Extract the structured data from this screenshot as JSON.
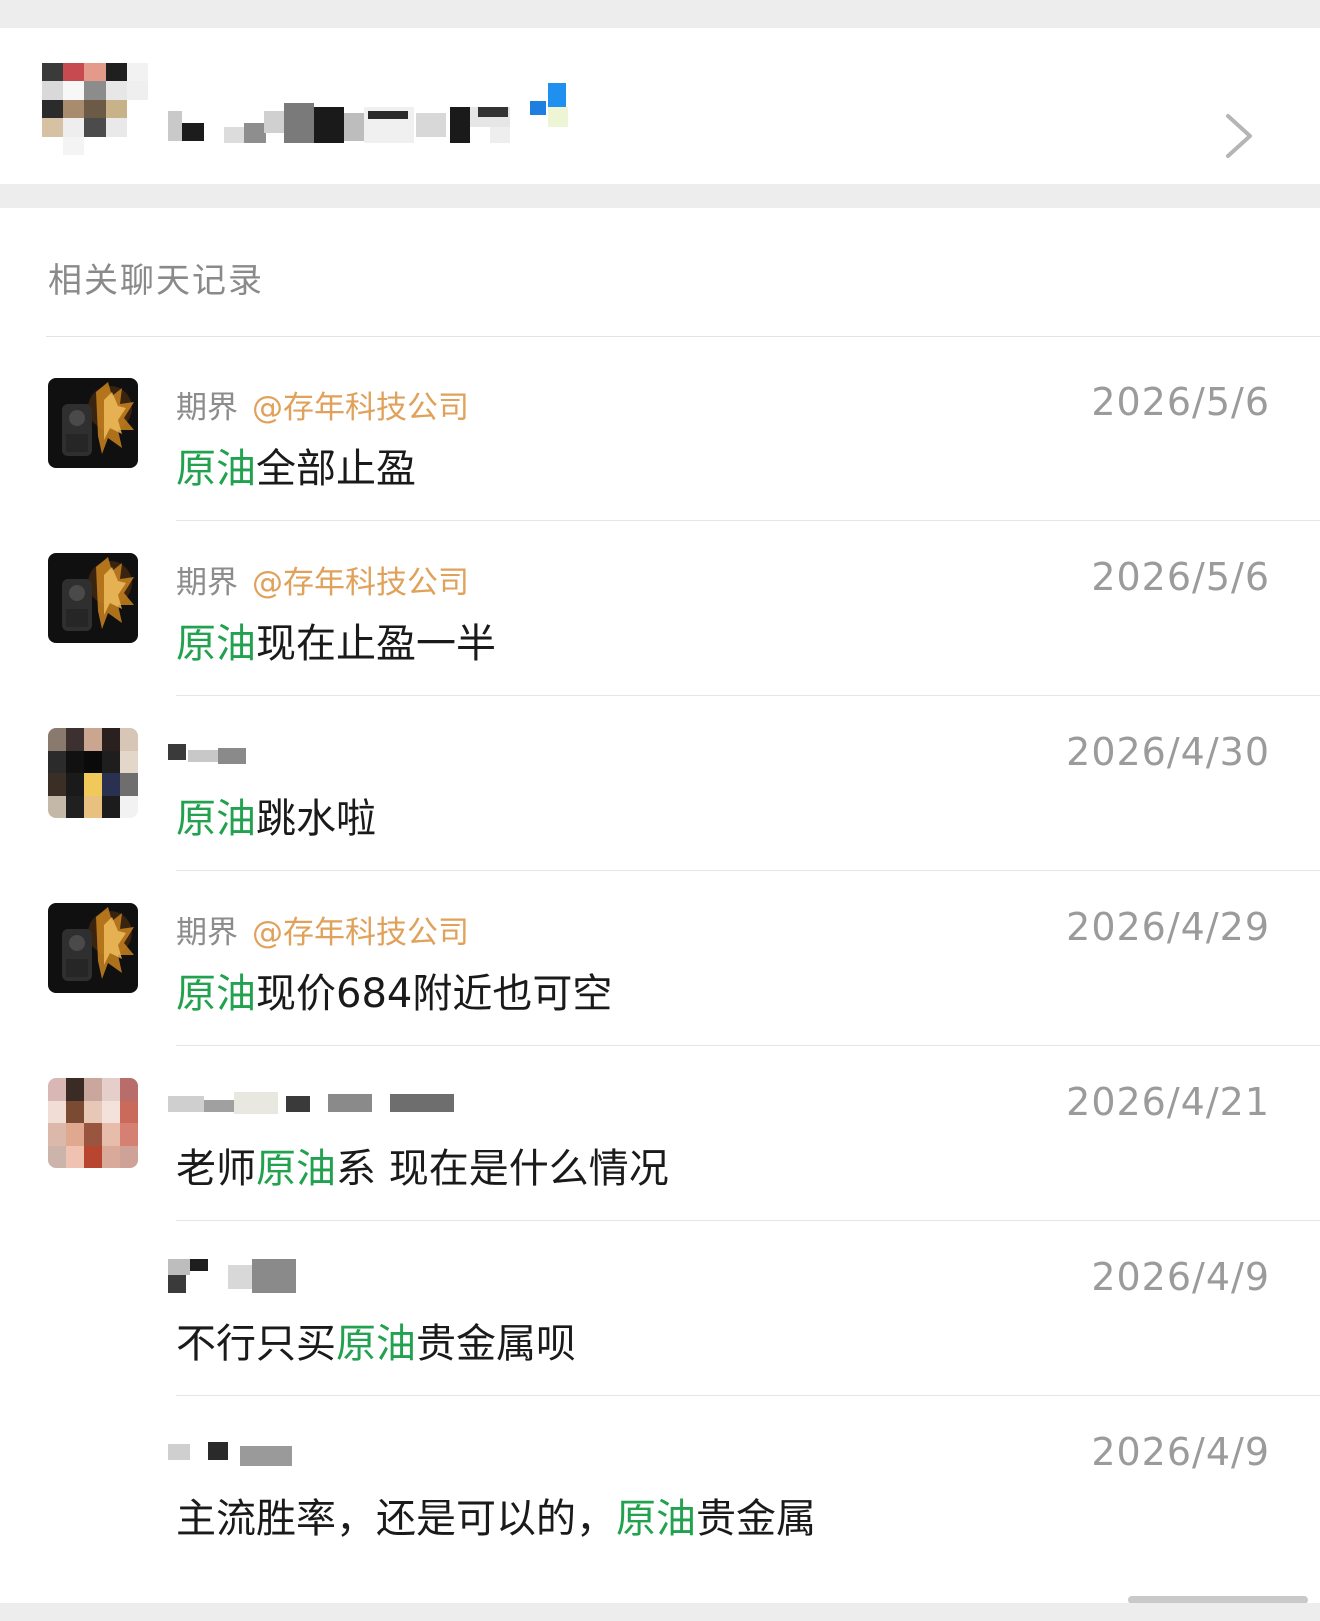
{
  "contact": {
    "chevron_icon": "chevron-right-icon"
  },
  "section": {
    "title": "相关聊天记录"
  },
  "records": [
    {
      "sender": "期界",
      "mention": "@存年科技公司",
      "date": "2026/5/6",
      "keyword": "原油",
      "before": "",
      "after": "全部止盈",
      "avatar": "dark"
    },
    {
      "sender": "期界",
      "mention": "@存年科技公司",
      "date": "2026/5/6",
      "keyword": "原油",
      "before": "",
      "after": "现在止盈一半",
      "avatar": "dark"
    },
    {
      "sender": "",
      "mention": "",
      "date": "2026/4/30",
      "keyword": "原油",
      "before": "",
      "after": "跳水啦",
      "avatar": "blur-a"
    },
    {
      "sender": "期界",
      "mention": "@存年科技公司",
      "date": "2026/4/29",
      "keyword": "原油",
      "before": "",
      "after": "现价684附近也可空",
      "avatar": "dark"
    },
    {
      "sender": "",
      "mention": "",
      "date": "2026/4/21",
      "keyword": "原油",
      "before": "老师",
      "after": "系 现在是什么情况",
      "avatar": "blur-b"
    },
    {
      "sender": "",
      "mention": "",
      "date": "2026/4/9",
      "keyword": "原油",
      "before": "不行只买",
      "after": "贵金属呗",
      "avatar": "none"
    },
    {
      "sender": "",
      "mention": "",
      "date": "2026/4/9",
      "keyword": "原油",
      "before": "主流胜率，还是可以的，",
      "after": "贵金属",
      "avatar": "none"
    }
  ],
  "colors": {
    "keyword": "#22a24f",
    "mention": "#e0a15a",
    "meta": "#8c8c8c",
    "date": "#9b9b9b"
  }
}
